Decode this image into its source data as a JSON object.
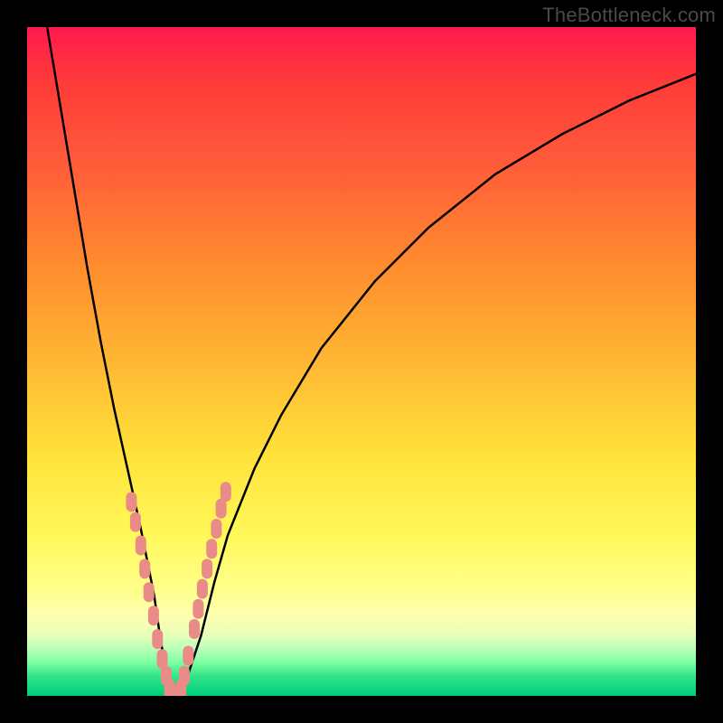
{
  "watermark": "TheBottleneck.com",
  "colors": {
    "frame": "#000000",
    "watermark": "#4a4a4a",
    "curve": "#000000",
    "marker": "#e98b87"
  },
  "chart_data": {
    "type": "line",
    "title": "",
    "xlabel": "",
    "ylabel": "",
    "xlim": [
      0,
      100
    ],
    "ylim": [
      0,
      100
    ],
    "grid": false,
    "legend": false,
    "note": "No axis tick labels or data labels visible; values estimated from curve geometry within plot area.",
    "series": [
      {
        "name": "bottleneck-curve",
        "x": [
          3,
          5,
          7,
          9,
          11,
          13,
          15,
          17,
          19,
          20,
          21,
          22,
          23,
          24,
          26,
          28,
          30,
          34,
          38,
          44,
          52,
          60,
          70,
          80,
          90,
          100
        ],
        "y": [
          100,
          88,
          76,
          64,
          53,
          43,
          34,
          25,
          15,
          8,
          3,
          0,
          0,
          3,
          9,
          17,
          24,
          34,
          42,
          52,
          62,
          70,
          78,
          84,
          89,
          93
        ]
      }
    ],
    "markers": {
      "name": "highlighted-points",
      "x": [
        15.6,
        16.2,
        17.0,
        17.6,
        18.2,
        18.9,
        19.5,
        20.2,
        20.8,
        21.3,
        22.0,
        22.4,
        23.0,
        23.5,
        24.1,
        25.0,
        25.6,
        26.2,
        26.9,
        27.6,
        28.3,
        29.0,
        29.7
      ],
      "y": [
        29.0,
        26.0,
        22.5,
        19.0,
        15.5,
        12.0,
        8.5,
        5.5,
        3.0,
        1.0,
        0.0,
        0.0,
        1.0,
        3.0,
        6.0,
        10.0,
        13.0,
        16.0,
        19.0,
        22.0,
        25.0,
        28.0,
        30.5
      ]
    }
  }
}
